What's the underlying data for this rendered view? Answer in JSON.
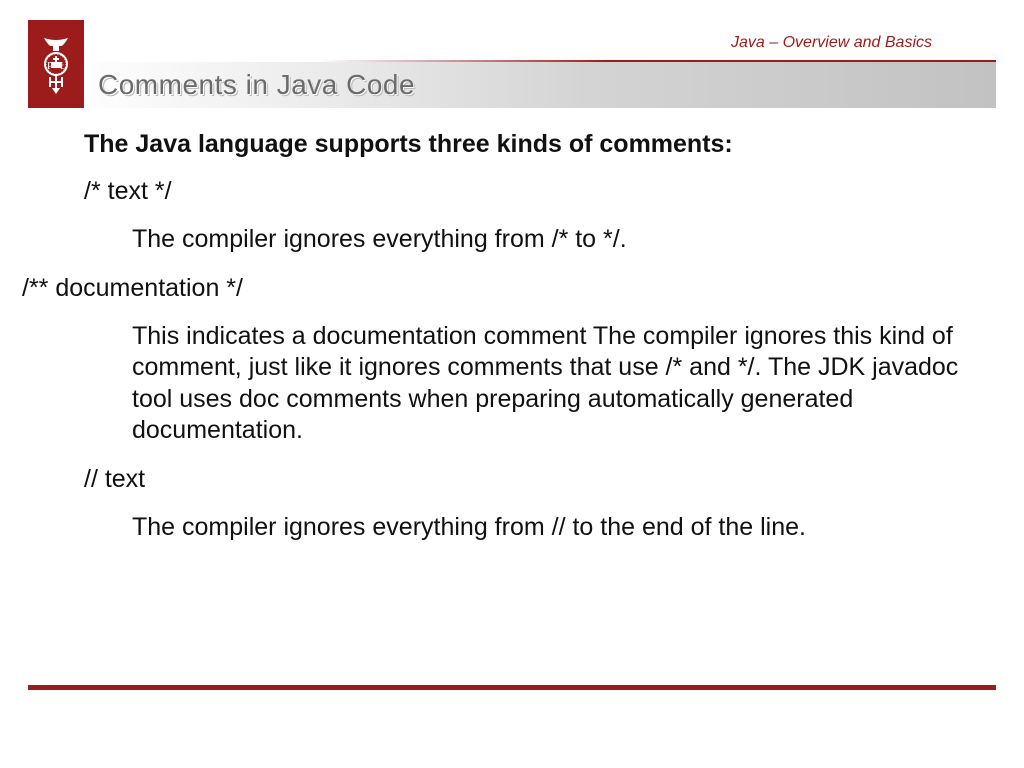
{
  "header": {
    "label": "Java – Overview and Basics"
  },
  "slide": {
    "title": "Comments in Java Code",
    "intro": "The Java language supports three kinds of comments:",
    "block1": {
      "syntax": "/* text */",
      "desc": "The compiler ignores everything from /* to */."
    },
    "block2": {
      "syntax": "/** documentation */",
      "desc": "This indicates a documentation comment The compiler ignores this kind of comment, just like it ignores comments that use /* and */. The JDK javadoc tool uses doc comments when preparing automatically generated documentation."
    },
    "block3": {
      "syntax": "// text",
      "desc": "The compiler ignores everything from // to the end of the line."
    }
  }
}
